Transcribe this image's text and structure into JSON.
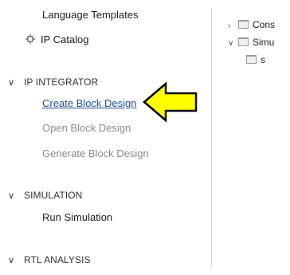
{
  "flow_navigator": {
    "language_templates": "Language Templates",
    "ip_catalog": "IP Catalog",
    "ip_integrator": {
      "header": "IP INTEGRATOR",
      "create_block_design": "Create Block Design",
      "open_block_design": "Open Block Design",
      "generate_block_design": "Generate Block Design"
    },
    "simulation": {
      "header": "SIMULATION",
      "run_simulation": "Run Simulation"
    },
    "rtl_analysis": {
      "header": "RTL ANALYSIS"
    }
  },
  "sources_tree": {
    "rows": [
      {
        "label": "Cons",
        "expanded": false
      },
      {
        "label": "Simu",
        "expanded": true
      },
      {
        "label": "s"
      }
    ]
  },
  "icons": {
    "chevron_down": "chevron-down-icon",
    "chevron_right": "chevron-right-icon",
    "ip_catalog": "ip-catalog-icon",
    "folder": "folder-icon",
    "pointer_arrow": "yellow-arrow-icon"
  },
  "colors": {
    "link": "#1f4e9e",
    "disabled": "#8a8a8a",
    "arrow_fill": "#ffff00",
    "arrow_stroke": "#000000"
  }
}
